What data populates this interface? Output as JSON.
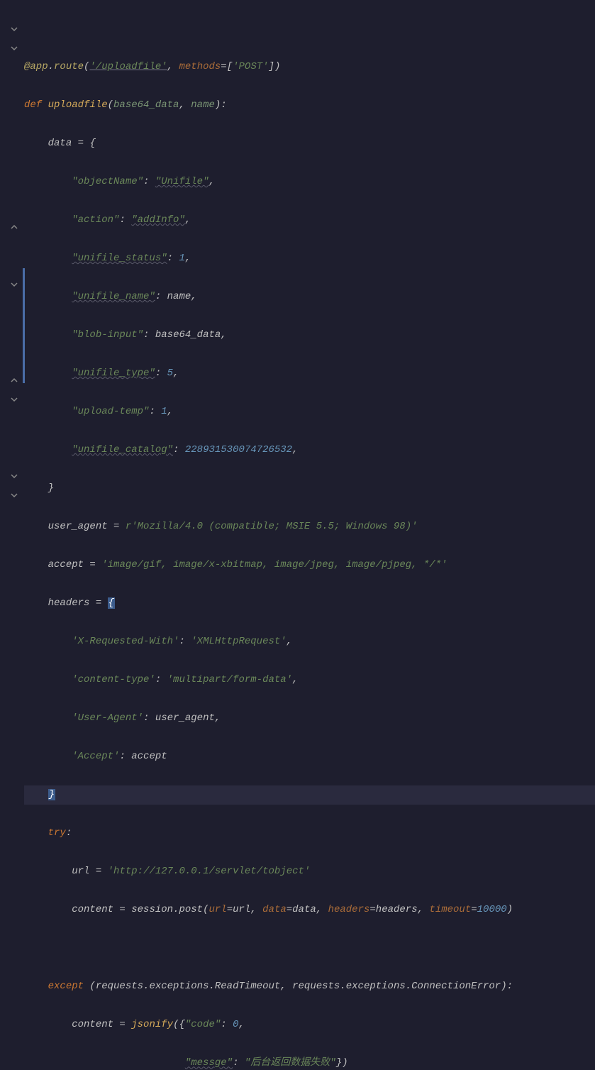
{
  "code": {
    "l1": {
      "at": "@",
      "app": "app",
      "dot": ".",
      "route": "route",
      "lp": "(",
      "str1": "'/uploadfile'",
      "comma": ", ",
      "methods": "methods",
      "eq": "=",
      "lb": "[",
      "post": "'POST'",
      "rb": "]",
      "rp": ")"
    },
    "l2": {
      "def": "def ",
      "name": "uploadfile",
      "lp": "(",
      "p1": "base64_data",
      "comma": ", ",
      "p2": "name",
      "rp": "):"
    },
    "l3": {
      "data": "data",
      "eq": " = ",
      "brace": "{"
    },
    "l4": {
      "key": "\"objectName\"",
      "colon": ": ",
      "val": "\"Unifile\"",
      "comma": ","
    },
    "l5": {
      "key": "\"action\"",
      "colon": ": ",
      "val": "\"addInfo\"",
      "comma": ","
    },
    "l6": {
      "key": "\"unifile_status\"",
      "colon": ": ",
      "val": "1",
      "comma": ","
    },
    "l7": {
      "key": "\"unifile_name\"",
      "colon": ": ",
      "val": "name",
      "comma": ","
    },
    "l8": {
      "key": "\"blob-input\"",
      "colon": ": ",
      "val": "base64_data",
      "comma": ","
    },
    "l9": {
      "key": "\"unifile_type\"",
      "colon": ": ",
      "val": "5",
      "comma": ","
    },
    "l10": {
      "key": "\"upload-temp\"",
      "colon": ": ",
      "val": "1",
      "comma": ","
    },
    "l11": {
      "key": "\"unifile_catalog\"",
      "colon": ": ",
      "val": "228931530074726532",
      "comma": ","
    },
    "l12": {
      "brace": "}"
    },
    "l13": {
      "var": "user_agent",
      "eq": " = ",
      "prefix": "r",
      "str": "'Mozilla/4.0 (compatible; MSIE 5.5; Windows 98)'"
    },
    "l14": {
      "var": "accept",
      "eq": " = ",
      "str": "'image/gif, image/x-xbitmap, image/jpeg, image/pjpeg, */*'"
    },
    "l15": {
      "var": "headers",
      "eq": " = ",
      "brace": "{"
    },
    "l16": {
      "key": "'X-Requested-With'",
      "colon": ": ",
      "val": "'XMLHttpRequest'",
      "comma": ","
    },
    "l17": {
      "key": "'content-type'",
      "colon": ": ",
      "val": "'multipart/form-data'",
      "comma": ","
    },
    "l18": {
      "key": "'User-Agent'",
      "colon": ": ",
      "val": "user_agent",
      "comma": ","
    },
    "l19": {
      "key": "'Accept'",
      "colon": ": ",
      "val": "accept"
    },
    "l20": {
      "brace": "}"
    },
    "l21": {
      "try": "try",
      "colon": ":"
    },
    "l22": {
      "var": "url",
      "eq": " = ",
      "str": "'http://127.0.0.1/servlet/tobject'"
    },
    "l23": {
      "var": "content",
      "eq": " = ",
      "session": "session",
      "dot": ".",
      "post": "post",
      "lp": "(",
      "k1": "url",
      "e1": "=",
      "v1": "url",
      "c1": ", ",
      "k2": "data",
      "e2": "=",
      "v2": "data",
      "c2": ", ",
      "k3": "headers",
      "e3": "=",
      "v3": "headers",
      "c3": ", ",
      "k4": "timeout",
      "e4": "=",
      "v4": "10000",
      "rp": ")"
    },
    "l25": {
      "except": "except ",
      "lp": "(",
      "r1": "requests",
      "d1": ".",
      "e1": "exceptions",
      "d2": ".",
      "rt": "ReadTimeout",
      "c": ", ",
      "r2": "requests",
      "d3": ".",
      "e2": "exceptions",
      "d4": ".",
      "ce": "ConnectionError",
      "rp": "):"
    },
    "l26": {
      "var": "content",
      "eq": " = ",
      "fn": "jsonify",
      "lp": "(",
      "brace": "{",
      "key": "\"code\"",
      "colon": ": ",
      "val": "0",
      "comma": ","
    },
    "l27": {
      "key": "\"messge\"",
      "colon": ": ",
      "val": "\"后台返回数据失败\"",
      "brace": "}",
      "rp": ")"
    }
  }
}
